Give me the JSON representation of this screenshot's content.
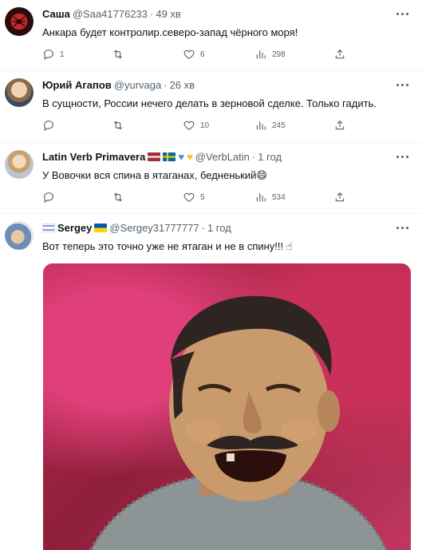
{
  "tweets": [
    {
      "name": "Саша",
      "handle": "@Saa41776233",
      "time": "49 хв",
      "text": "Анкара будет контролир.северо-запад чёрного моря!",
      "stats": {
        "replies": "1",
        "retweets": "",
        "likes": "6",
        "views": "298"
      }
    },
    {
      "name": "Юрий Агапов",
      "handle": "@yurvaga",
      "time": "26 хв",
      "text": "В сущности, России нечего делать в зерновой сделке. Только гадить.",
      "stats": {
        "replies": "",
        "retweets": "",
        "likes": "10",
        "views": "245"
      }
    },
    {
      "name": "Latin Verb Primavera",
      "handle": "@VerbLatin",
      "time": "1 год",
      "text": "У Вовочки вся спина в ятаганах, бедненький😄",
      "stats": {
        "replies": "",
        "retweets": "",
        "likes": "5",
        "views": "534"
      }
    },
    {
      "name": "Sergey",
      "handle": "@Sergey31777777",
      "time": "1 год",
      "text": "Вот теперь это точно уже не ятаган и не в спину!!! ☝",
      "media": "laughing-man-photo"
    }
  ],
  "separator": "·",
  "colors": {
    "text": "#0f1419",
    "secondary": "#536471",
    "border": "#eff3f4"
  }
}
